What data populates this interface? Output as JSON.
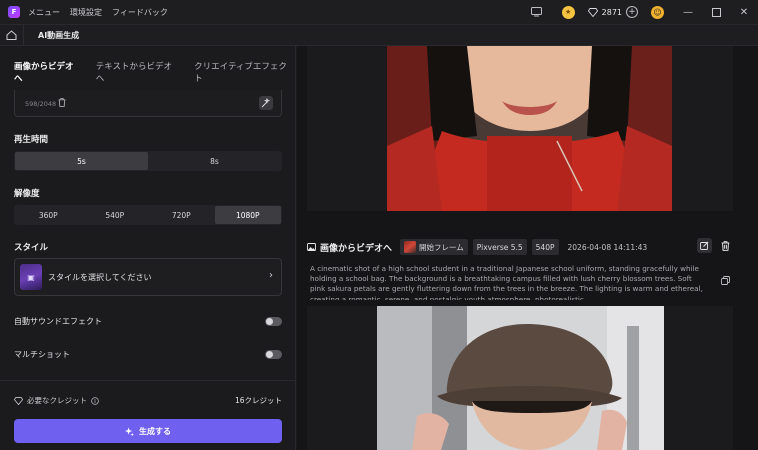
{
  "titlebar": {
    "menu": [
      "メニュー",
      "環境設定",
      "フィードバック"
    ],
    "credits": "2871"
  },
  "breadcrumb": {
    "title": "AI動画生成"
  },
  "left": {
    "tabs": [
      "画像からビデオへ",
      "テキストからビデオへ",
      "クリエイティブエフェクト"
    ],
    "active_tab": 0,
    "prompt": {
      "char_count": "598/2048"
    },
    "duration": {
      "label": "再生時間",
      "options": [
        "5s",
        "8s"
      ],
      "selected": "5s"
    },
    "resolution": {
      "label": "解像度",
      "options": [
        "360P",
        "540P",
        "720P",
        "1080P"
      ],
      "selected": "1080P"
    },
    "style": {
      "label": "スタイル",
      "placeholder": "スタイルを選択してください"
    },
    "toggles": [
      {
        "label": "自動サウンドエフェクト",
        "on": false
      },
      {
        "label": "マルチショット",
        "on": false
      }
    ],
    "required_credits_label": "必要なクレジット",
    "required_credits_value": "16クレジット",
    "generate_label": "生成する"
  },
  "right": {
    "item": {
      "title": "画像からビデオへ",
      "chips": [
        "開始フレーム",
        "Pixverse 5.5",
        "540P"
      ],
      "date": "2026-04-08 14:11:43",
      "description": "A cinematic shot of a high school student in a traditional Japanese school uniform, standing gracefully while holding a school bag. The background is a breathtaking campus filled with lush cherry blossom trees. Soft pink sakura petals are gently fluttering down from the trees in the breeze. The lighting is warm and ethereal, creating a romantic, serene, and nostalgic youth atmosphere, photorealistic."
    }
  },
  "colors": {
    "accent": "#7060f0",
    "background": "#1b1b1e",
    "panel_dark": "#151517"
  }
}
